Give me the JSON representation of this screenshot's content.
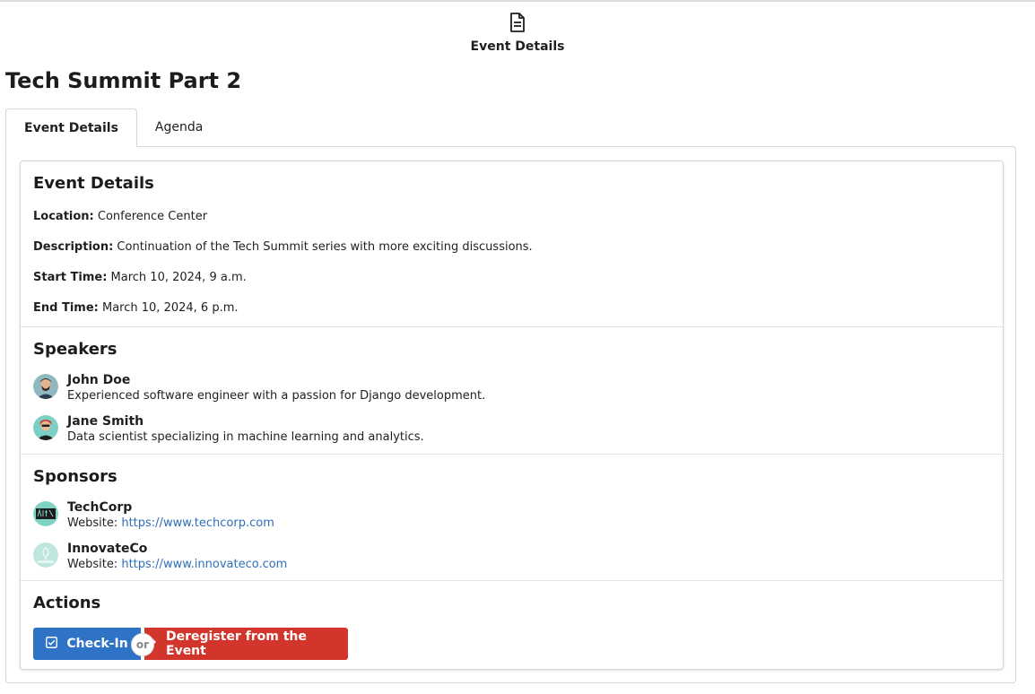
{
  "header": {
    "icon": "document-icon",
    "label": "Event Details"
  },
  "page": {
    "title": "Tech Summit Part 2"
  },
  "tabs": [
    {
      "label": "Event Details",
      "active": true
    },
    {
      "label": "Agenda",
      "active": false
    }
  ],
  "details": {
    "heading": "Event Details",
    "rows": [
      {
        "label": "Location:",
        "value": "Conference Center"
      },
      {
        "label": "Description:",
        "value": "Continuation of the Tech Summit series with more exciting discussions."
      },
      {
        "label": "Start Time:",
        "value": "March 10, 2024, 9 a.m."
      },
      {
        "label": "End Time:",
        "value": "March 10, 2024, 6 p.m."
      }
    ]
  },
  "speakers": {
    "heading": "Speakers",
    "items": [
      {
        "name": "John Doe",
        "bio": "Experienced software engineer with a passion for Django development."
      },
      {
        "name": "Jane Smith",
        "bio": "Data scientist specializing in machine learning and analytics."
      }
    ]
  },
  "sponsors": {
    "heading": "Sponsors",
    "website_label": "Website:",
    "items": [
      {
        "name": "TechCorp",
        "url": "https://www.techcorp.com"
      },
      {
        "name": "InnovateCo",
        "url": "https://www.innovateco.com"
      }
    ]
  },
  "actions": {
    "heading": "Actions",
    "checkin_label": "Check-In",
    "or_label": "or",
    "deregister_label": "Deregister from the Event"
  },
  "colors": {
    "checkin": "#2f73c7",
    "deregister": "#d2352b",
    "link": "#2f6fb9"
  }
}
